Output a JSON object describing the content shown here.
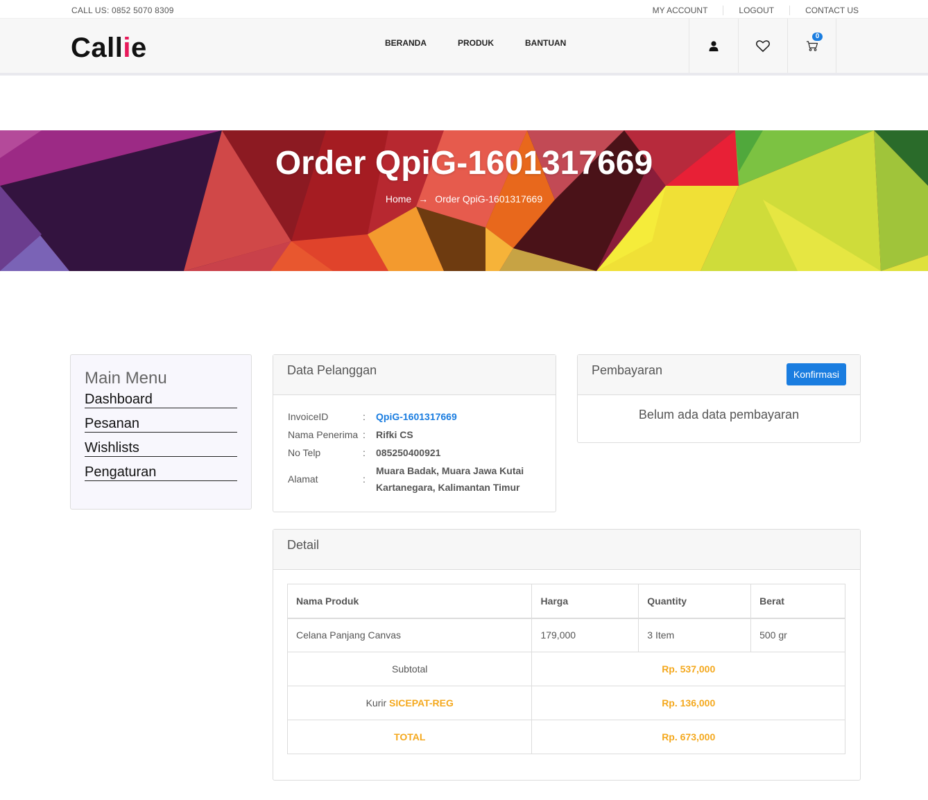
{
  "topbar": {
    "phone": "CALL US: 0852 5070 8309",
    "links": [
      "MY ACCOUNT",
      "LOGOUT",
      "CONTACT US"
    ]
  },
  "header": {
    "logo_main": "Call",
    "logo_accent": "i",
    "logo_end": "e",
    "nav": [
      "BERANDA",
      "PRODUK",
      "BANTUAN"
    ],
    "icons": [
      "user-icon",
      "heart-icon",
      "cart-icon"
    ],
    "cart_count": "0"
  },
  "hero": {
    "title": "Order QpiG-1601317669",
    "crumb_home": "Home",
    "crumb_arrow": "→",
    "crumb_current": "Order QpiG-1601317669"
  },
  "sidebar": {
    "title": "Main Menu",
    "items": [
      "Dashboard",
      "Pesanan",
      "Wishlists",
      "Pengaturan"
    ]
  },
  "customer": {
    "title": "Data Pelanggan",
    "rows": [
      {
        "label": "InvoiceID",
        "sep": ":",
        "value": "QpiG-1601317669"
      },
      {
        "label": "Nama Penerima",
        "sep": ":",
        "value": "Rifki CS"
      },
      {
        "label": "No Telp",
        "sep": ":",
        "value": "085250400921"
      },
      {
        "label": "Alamat",
        "sep": ":",
        "value": "Muara Badak, Muara Jawa Kutai Kartanegara, Kalimantan Timur"
      }
    ]
  },
  "payment": {
    "title": "Pembayaran",
    "button": "Konfirmasi",
    "empty": "Belum ada data pembayaran"
  },
  "detail": {
    "title": "Detail",
    "headers": [
      "Nama Produk",
      "Harga",
      "Quantity",
      "Berat"
    ],
    "item": {
      "name": "Celana Panjang Canvas",
      "price": "179,000",
      "qty": "3 Item",
      "weight": "500 gr"
    },
    "subtotal_label": "Subtotal",
    "subtotal_value": "Rp. 537,000",
    "courier_label": "Kurir",
    "courier_name": "SICEPAT-REG",
    "courier_value": "Rp. 136,000",
    "total_label": "TOTAL",
    "total_value": "Rp. 673,000"
  },
  "colors": {
    "accent": "#e8195a",
    "primary": "#1a7de0",
    "gold": "#f4a81d"
  }
}
